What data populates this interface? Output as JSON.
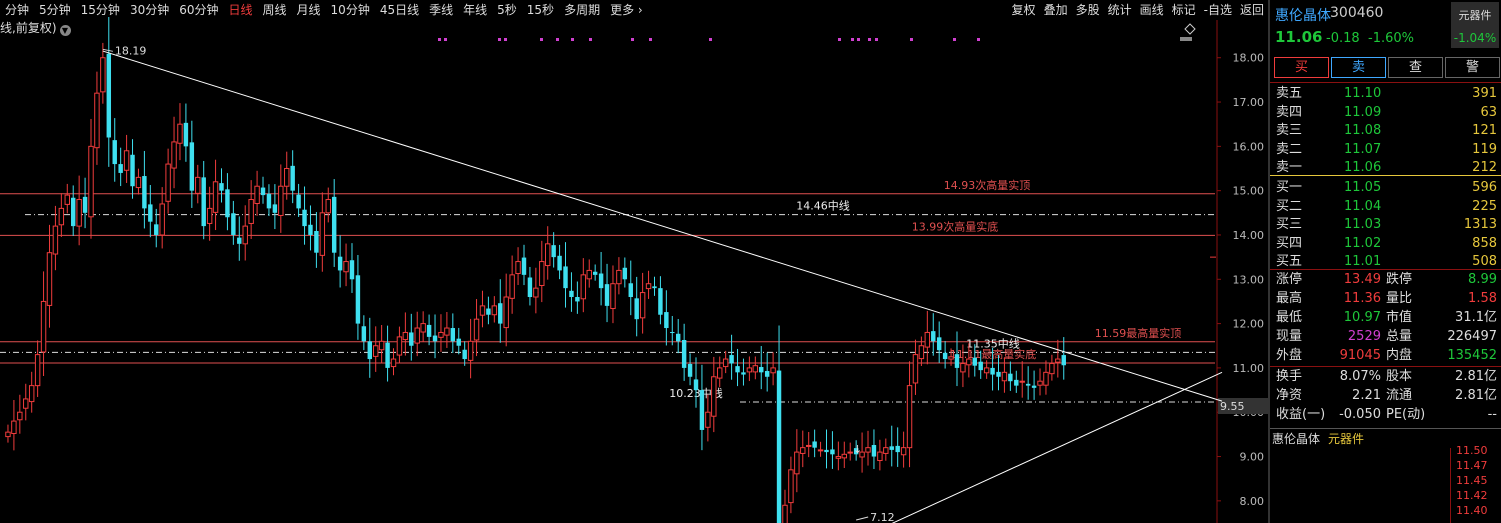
{
  "toolbar": {
    "periods": [
      "分钟",
      "5分钟",
      "15分钟",
      "30分钟",
      "60分钟",
      "日线",
      "周线",
      "月线",
      "10分钟",
      "45日线",
      "季线",
      "年线",
      "5秒",
      "15秒",
      "多周期",
      "更多 ›"
    ],
    "active_period": "日线",
    "right_tools": [
      "复权",
      "叠加",
      "多股",
      "统计",
      "画线",
      "标记",
      "-自选",
      "返回"
    ]
  },
  "chart_header": {
    "label": "线,前复权)"
  },
  "colors": {
    "up": "#f03c3c",
    "down": "#3fe0f0",
    "green": "#1ec73a",
    "blue": "#3fa8ff",
    "yellow": "#e6c73c",
    "magenta": "#d040d0",
    "level_line": "#e05050"
  },
  "chart_data": {
    "type": "candlestick",
    "y_axis": {
      "min": 7.5,
      "max": 18.4,
      "ticks": [
        18.0,
        17.0,
        16.0,
        15.0,
        14.0,
        13.0,
        12.0,
        11.0,
        10.0,
        9.0,
        8.0
      ],
      "highlight": "9.55"
    },
    "x_count": 204,
    "high_marker": {
      "label": "18.19",
      "index": 16,
      "value": 18.19
    },
    "low_marker": {
      "label": "7.12",
      "index": 143,
      "value": 7.12
    },
    "levels": [
      {
        "label": "14.93次高量实顶",
        "value": 14.93,
        "style": "solid"
      },
      {
        "label": "14.46中线",
        "value": 14.46,
        "style": "dashdot"
      },
      {
        "label": "13.99次高量实底",
        "value": 13.99,
        "style": "solid"
      },
      {
        "label": "11.59最高量实顶",
        "value": 11.59,
        "style": "solid"
      },
      {
        "label": "11.35中线",
        "value": 11.35,
        "style": "dashdot"
      },
      {
        "label": "11.11最高量实底",
        "value": 11.11,
        "style": "solid"
      },
      {
        "label": "10.23中线",
        "value": 10.23,
        "style": "dashdot"
      }
    ],
    "trendlines": [
      {
        "from": [
          16,
          18.15
        ],
        "to": [
          203,
          10.25
        ]
      },
      {
        "from": [
          143,
          7.12
        ],
        "to": [
          203,
          10.9
        ]
      }
    ],
    "closes": [
      9.55,
      9.8,
      10.0,
      10.3,
      10.6,
      11.3,
      12.5,
      13.6,
      14.2,
      14.6,
      14.9,
      14.2,
      14.8,
      14.5,
      16.0,
      17.2,
      18.0,
      16.2,
      15.6,
      15.4,
      15.9,
      15.1,
      15.3,
      14.6,
      14.3,
      14.0,
      14.7,
      15.6,
      16.1,
      16.5,
      16.0,
      15.0,
      15.3,
      14.2,
      14.6,
      15.2,
      15.0,
      14.4,
      14.0,
      13.8,
      14.2,
      14.8,
      15.1,
      14.9,
      14.6,
      14.5,
      15.1,
      15.5,
      15.0,
      14.6,
      14.2,
      14.0,
      13.6,
      14.5,
      14.8,
      13.6,
      13.2,
      13.4,
      13.0,
      12.0,
      11.6,
      11.2,
      11.5,
      11.6,
      11.0,
      11.2,
      11.7,
      11.8,
      11.5,
      11.9,
      12.0,
      11.7,
      11.6,
      11.8,
      11.9,
      11.6,
      11.5,
      11.2,
      11.6,
      12.1,
      12.4,
      12.2,
      12.4,
      12.0,
      12.6,
      13.1,
      13.4,
      13.1,
      12.6,
      12.8,
      13.4,
      13.8,
      13.5,
      13.2,
      12.8,
      12.6,
      12.5,
      13.1,
      13.2,
      13.1,
      12.8,
      12.4,
      12.9,
      13.2,
      13.0,
      12.6,
      12.1,
      12.7,
      12.9,
      12.8,
      12.2,
      11.9,
      11.8,
      11.6,
      11.0,
      10.8,
      10.5,
      9.6,
      10.0,
      10.8,
      11.0,
      11.2,
      11.1,
      10.9,
      10.85,
      11.0,
      11.05,
      10.9,
      10.8,
      11.0,
      7.2,
      7.9,
      8.7,
      9.1,
      9.2,
      9.25,
      9.2,
      9.15,
      9.1,
      9.05,
      9.0,
      9.05,
      9.1,
      9.05,
      9.1,
      9.2,
      9.0,
      9.1,
      9.2,
      9.15,
      9.1,
      9.2,
      10.6,
      11.3,
      11.5,
      11.8,
      11.6,
      11.4,
      11.2,
      11.25,
      11.0,
      11.1,
      11.2,
      11.05,
      10.95,
      11.0,
      10.85,
      10.8,
      10.9,
      10.7,
      10.6,
      10.7,
      10.6,
      10.55,
      10.7,
      10.9,
      11.1,
      11.2,
      11.06
    ]
  },
  "panel": {
    "name": "惠伦晶体",
    "code": "300460",
    "price": "11.06",
    "change": "-0.18",
    "pct": "-1.60%",
    "sector_name": "元器件",
    "sector_pct": "-1.04%",
    "buttons": {
      "buy": "买",
      "sell": "卖",
      "query": "查",
      "alert": "警"
    },
    "asks": [
      {
        "label": "卖五",
        "price": "11.10",
        "vol": "391"
      },
      {
        "label": "卖四",
        "price": "11.09",
        "vol": "63"
      },
      {
        "label": "卖三",
        "price": "11.08",
        "vol": "121"
      },
      {
        "label": "卖二",
        "price": "11.07",
        "vol": "119"
      },
      {
        "label": "卖一",
        "price": "11.06",
        "vol": "212"
      }
    ],
    "bids": [
      {
        "label": "买一",
        "price": "11.05",
        "vol": "596"
      },
      {
        "label": "买二",
        "price": "11.04",
        "vol": "225"
      },
      {
        "label": "买三",
        "price": "11.03",
        "vol": "1313"
      },
      {
        "label": "买四",
        "price": "11.02",
        "vol": "858"
      },
      {
        "label": "买五",
        "price": "11.01",
        "vol": "508"
      }
    ],
    "stats": [
      {
        "l1": "涨停",
        "v1": "13.49",
        "c1": "red",
        "l2": "跌停",
        "v2": "8.99",
        "c2": "green"
      },
      {
        "l1": "最高",
        "v1": "11.36",
        "c1": "red",
        "l2": "量比",
        "v2": "1.58",
        "c2": "red"
      },
      {
        "l1": "最低",
        "v1": "10.97",
        "c1": "green",
        "l2": "市值",
        "v2": "31.1亿",
        "c2": "white"
      },
      {
        "l1": "现量",
        "v1": "2529",
        "c1": "mag",
        "l2": "总量",
        "v2": "226497",
        "c2": "white"
      },
      {
        "l1": "外盘",
        "v1": "91045",
        "c1": "red",
        "l2": "内盘",
        "v2": "135452",
        "c2": "green"
      }
    ],
    "stats2": [
      {
        "l1": "换手",
        "v1": "8.07%",
        "c1": "white",
        "l2": "股本",
        "v2": "2.81亿",
        "c2": "white"
      },
      {
        "l1": "净资",
        "v1": "2.21",
        "c1": "white",
        "l2": "流通",
        "v2": "2.81亿",
        "c2": "white"
      },
      {
        "l1": "收益(一)",
        "v1": "-0.050",
        "c1": "white",
        "l2": "PE(动)",
        "v2": "--",
        "c2": "white"
      }
    ],
    "mini": {
      "name": "惠伦晶体",
      "tag": "元器件",
      "axis": [
        "11.50",
        "11.47",
        "11.45",
        "11.42",
        "11.40"
      ]
    }
  }
}
